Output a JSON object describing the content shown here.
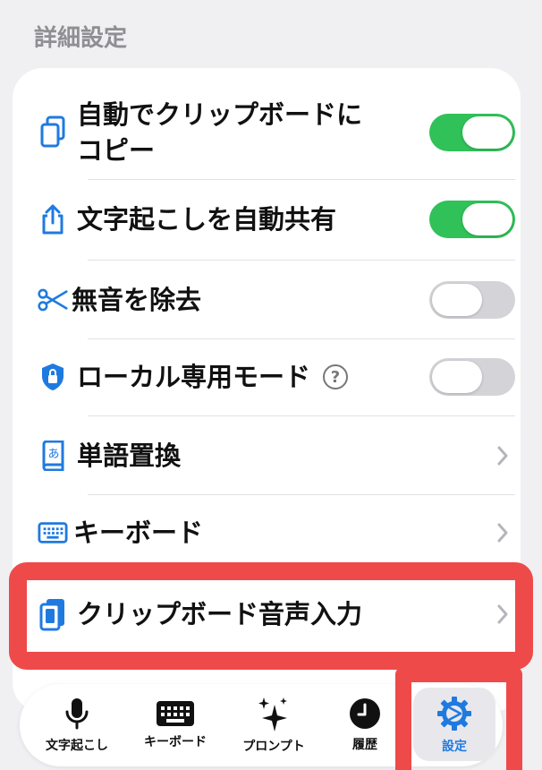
{
  "section_title": "詳細設定",
  "rows": [
    {
      "label_line1": "自動でクリップボードに",
      "label_line2": "コピー",
      "icon": "copy-document-icon",
      "control": "toggle",
      "on": true
    },
    {
      "label": "文字起こしを自動共有",
      "icon": "share-icon",
      "control": "toggle",
      "on": true
    },
    {
      "label": "無音を除去",
      "icon": "scissors-icon",
      "control": "toggle",
      "on": false
    },
    {
      "label": "ローカル専用モード",
      "icon": "shield-lock-icon",
      "control": "toggle",
      "on": false,
      "help": "?"
    },
    {
      "label": "単語置換",
      "icon": "dictionary-book-icon",
      "control": "chevron"
    },
    {
      "label": "キーボード",
      "icon": "keyboard-icon",
      "control": "chevron"
    },
    {
      "label": "クリップボード音声入力",
      "icon": "clipboard-phone-icon",
      "control": "chevron",
      "highlighted": true
    }
  ],
  "tabs": [
    {
      "label": "文字起こし",
      "icon": "microphone-icon"
    },
    {
      "label": "キーボード",
      "icon": "keyboard-icon"
    },
    {
      "label": "プロンプト",
      "icon": "sparkles-icon"
    },
    {
      "label": "履歴",
      "icon": "clock-icon"
    },
    {
      "label": "設定",
      "icon": "gear-icon",
      "active": true
    }
  ],
  "colors": {
    "accent": "#1f7ae0",
    "toggle_on": "#30c158",
    "toggle_off": "#d4d4d8",
    "highlight": "#ef4a4a"
  }
}
